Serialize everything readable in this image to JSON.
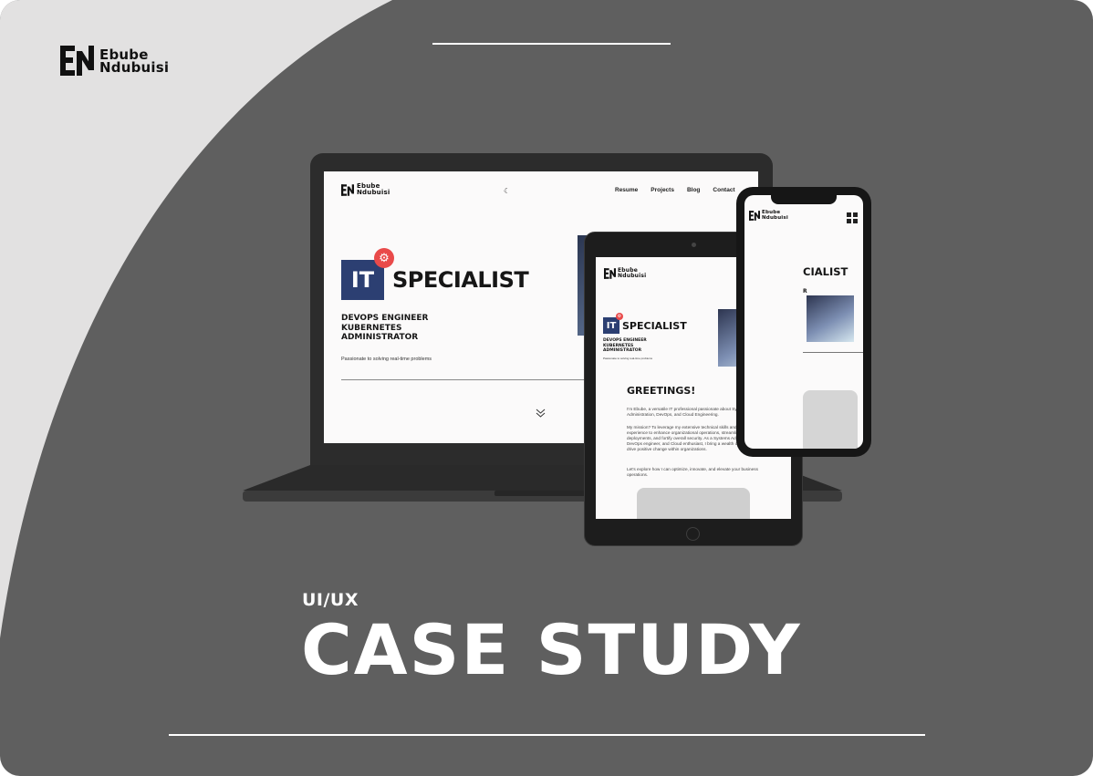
{
  "brand": {
    "line1": "Ebube",
    "line2": "Ndubuisi"
  },
  "colors": {
    "background": "#5f5f5f",
    "curve": "#e2e1e1",
    "it_blue": "#2c3f72",
    "badge_red": "#e94a4a"
  },
  "laptop": {
    "nav": [
      "Resume",
      "Projects",
      "Blog",
      "Contact"
    ],
    "moon_icon": "☾",
    "it": "IT",
    "specialist": "SPECIALIST",
    "roles": [
      "DEVOPS ENGINEER",
      "KUBERNETES",
      "ADMINISTRATOR"
    ],
    "tagline": "Passionate to solving real-time problems",
    "chevron": "⌄"
  },
  "tablet": {
    "it": "IT",
    "specialist": "SPECIALIST",
    "roles": [
      "DEVOPS ENGINEER",
      "KUBERNETES",
      "ADMINISTRATOR"
    ],
    "tagline": "Passionate to solving real-time problems",
    "greeting": "GREETINGS!",
    "paragraphs": [
      "I'm Ebube, a versatile IT professional passionate about Systems Administration, DevOps, and Cloud Engineering.",
      "My mission? To leverage my extensive technical skills and proven experience to enhance organizational operations, streamline application deployments, and fortify overall security. As a Systems Administrator, DevOps engineer, and Cloud enthusiast, I bring a wealth of expertise to drive positive change within organizations.",
      "Let's explore how I can optimize, innovate, and elevate your business operations."
    ]
  },
  "phone": {
    "specialist": "CIALIST",
    "role_fragment": "R"
  },
  "headline": {
    "small": "UI/UX",
    "large": "CASE STUDY"
  }
}
